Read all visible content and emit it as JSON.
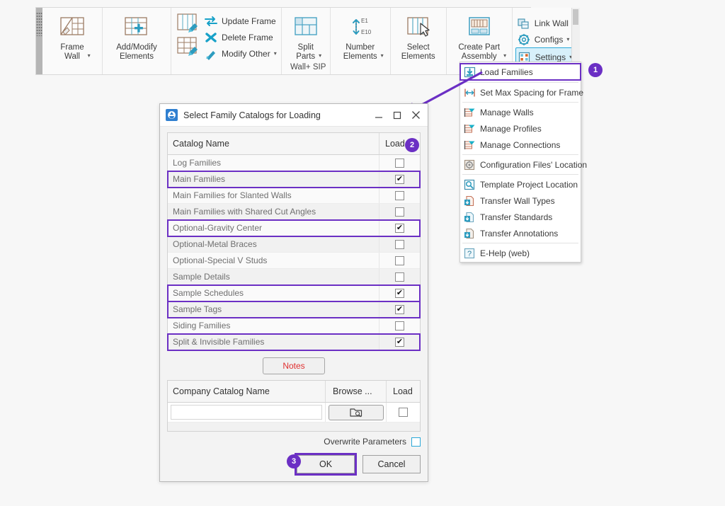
{
  "ribbon": {
    "panel_label": "Wall+ SIP",
    "buttons": [
      {
        "id": "frame-wall",
        "label_line1": "Frame",
        "label_line2": "Wall",
        "icon": "frame-wall-icon",
        "has_caret": true
      },
      {
        "id": "add-modify-elements",
        "label_line1": "Add/Modify",
        "label_line2": "Elements",
        "icon": "add-modify-elements-icon",
        "has_caret": false
      },
      {
        "id": "split-parts",
        "label_line1": "Split",
        "label_line2": "Parts",
        "icon": "split-parts-icon",
        "has_caret": true
      },
      {
        "id": "number-elements",
        "label_line1": "Number",
        "label_line2": "Elements",
        "icon": "number-elements-icon",
        "has_caret": true
      },
      {
        "id": "select-elements",
        "label_line1": "Select",
        "label_line2": "Elements",
        "icon": "select-elements-icon",
        "has_caret": false
      },
      {
        "id": "create-part-assembly",
        "label_line1": "Create Part",
        "label_line2": "Assembly",
        "icon": "create-part-assembly-icon",
        "has_caret": true
      }
    ],
    "frame_commands": [
      {
        "id": "update-frame",
        "label": "Update Frame",
        "icon": "update-frame-icon",
        "has_caret": false
      },
      {
        "id": "delete-frame",
        "label": "Delete Frame",
        "icon": "delete-frame-icon",
        "has_caret": false
      },
      {
        "id": "modify-other",
        "label": "Modify Other",
        "icon": "modify-other-icon",
        "has_caret": true
      }
    ],
    "right_commands": [
      {
        "id": "link-wall",
        "label": "Link Wall",
        "icon": "link-wall-icon",
        "has_caret": false,
        "highlighted": false
      },
      {
        "id": "configs",
        "label": "Configs",
        "icon": "configs-icon",
        "has_caret": true,
        "highlighted": false
      },
      {
        "id": "settings",
        "label": "Settings",
        "icon": "settings-icon",
        "has_caret": true,
        "highlighted": true
      }
    ],
    "number_elements_top_label": "E1",
    "number_elements_bottom_label": "E10"
  },
  "menu": {
    "items": [
      {
        "label": "Load Families",
        "icon": "load-families-icon",
        "highlighted": true,
        "separator_after": true
      },
      {
        "label": "Set Max Spacing for Frame",
        "icon": "max-spacing-icon",
        "highlighted": false,
        "separator_after": true
      },
      {
        "label": "Manage Walls",
        "icon": "manage-walls-icon",
        "highlighted": false,
        "separator_after": false
      },
      {
        "label": "Manage Profiles",
        "icon": "manage-profiles-icon",
        "highlighted": false,
        "separator_after": false
      },
      {
        "label": "Manage Connections",
        "icon": "manage-connections-icon",
        "highlighted": false,
        "separator_after": true
      },
      {
        "label": "Configuration Files' Location",
        "icon": "config-files-location-icon",
        "highlighted": false,
        "separator_after": true
      },
      {
        "label": "Template Project Location",
        "icon": "template-project-location-icon",
        "highlighted": false,
        "separator_after": false
      },
      {
        "label": "Transfer Wall Types",
        "icon": "transfer-wall-types-icon",
        "highlighted": false,
        "separator_after": false
      },
      {
        "label": "Transfer Standards",
        "icon": "transfer-standards-icon",
        "highlighted": false,
        "separator_after": false
      },
      {
        "label": "Transfer Annotations",
        "icon": "transfer-annotations-icon",
        "highlighted": false,
        "separator_after": true
      },
      {
        "label": "E-Help (web)",
        "icon": "e-help-icon",
        "highlighted": false,
        "separator_after": false
      }
    ]
  },
  "badges": {
    "step1": "1",
    "step2": "2",
    "step3": "3",
    "color": "#6b2fc4"
  },
  "dialog": {
    "title": "Select Family Catalogs for Loading",
    "window_buttons": {
      "minimize": "minimize-icon",
      "maximize": "maximize-icon",
      "close": "close-icon"
    },
    "catalog_grid": {
      "headers": {
        "name": "Catalog Name",
        "load": "Load"
      },
      "rows": [
        {
          "name": "Log Families",
          "checked": false,
          "highlighted": false
        },
        {
          "name": "Main Families",
          "checked": true,
          "highlighted": true
        },
        {
          "name": "Main Families for Slanted Walls",
          "checked": false,
          "highlighted": false
        },
        {
          "name": "Main Families with Shared Cut Angles",
          "checked": false,
          "highlighted": false
        },
        {
          "name": "Optional-Gravity Center",
          "checked": true,
          "highlighted": true
        },
        {
          "name": "Optional-Metal Braces",
          "checked": false,
          "highlighted": false
        },
        {
          "name": "Optional-Special V Studs",
          "checked": false,
          "highlighted": false
        },
        {
          "name": "Sample Details",
          "checked": false,
          "highlighted": false
        },
        {
          "name": "Sample Schedules",
          "checked": true,
          "highlighted": true
        },
        {
          "name": "Sample Tags",
          "checked": true,
          "highlighted": true
        },
        {
          "name": "Siding Families",
          "checked": false,
          "highlighted": false
        },
        {
          "name": "Split & Invisible Families",
          "checked": true,
          "highlighted": true
        }
      ]
    },
    "notes_button": "Notes",
    "company_grid": {
      "headers": {
        "name": "Company Catalog Name",
        "browse": "Browse ...",
        "load": "Load"
      },
      "row": {
        "name_value": "",
        "name_placeholder": "",
        "browse_icon": "browse-folder-icon",
        "checked": false
      }
    },
    "overwrite": {
      "label": "Overwrite Parameters",
      "checked": false
    },
    "ok_button": "OK",
    "cancel_button": "Cancel"
  }
}
